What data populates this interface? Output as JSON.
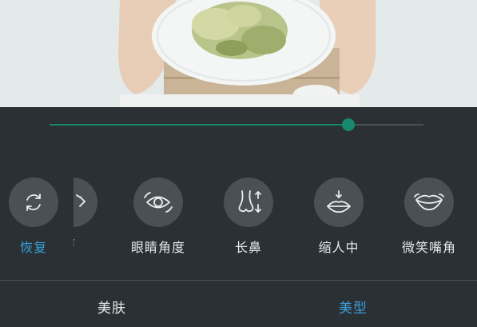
{
  "slider": {
    "value_fraction": 0.8
  },
  "tools": [
    {
      "label": "恢复",
      "icon": "refresh-icon",
      "active": true
    },
    {
      "label": "距",
      "icon": "distance-icon",
      "partial": true
    },
    {
      "label": "眼睛角度",
      "icon": "eye-angle-icon"
    },
    {
      "label": "长鼻",
      "icon": "nose-icon"
    },
    {
      "label": "缩人中",
      "icon": "philtrum-icon"
    },
    {
      "label": "微笑嘴角",
      "icon": "smile-lips-icon"
    }
  ],
  "tabs": [
    {
      "label": "美肤",
      "active": false
    },
    {
      "label": "美型",
      "active": true
    }
  ],
  "colors": {
    "accent": "#3aa0db",
    "slider": "#16896f",
    "panel_bg": "#2a3034",
    "icon_circle": "#4a5155"
  }
}
